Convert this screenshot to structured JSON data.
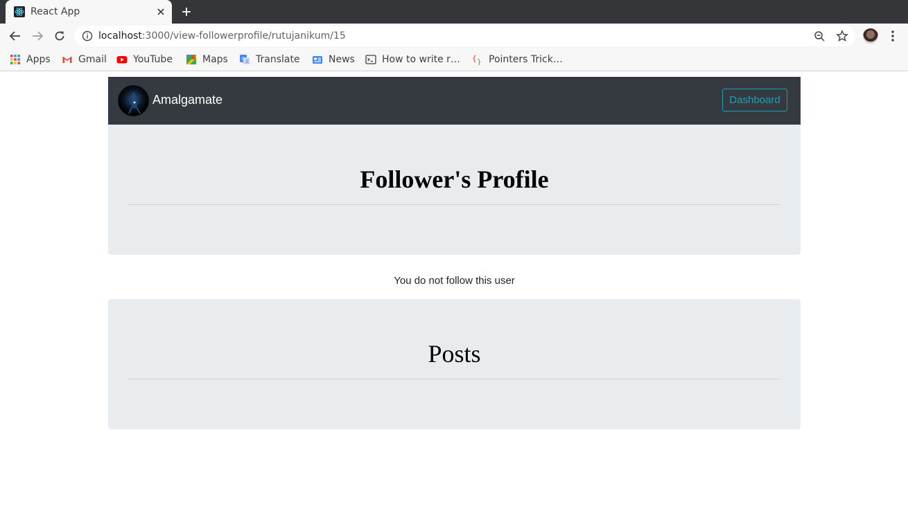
{
  "browser": {
    "tab": {
      "title": "React App",
      "favicon": "react-icon"
    },
    "url": {
      "host": "localhost",
      "path": ":3000/view-followerprofile/rutujanikum/15"
    },
    "bookmarks": [
      {
        "label": "Apps",
        "icon": "apps-grid-icon"
      },
      {
        "label": "Gmail",
        "icon": "gmail-icon"
      },
      {
        "label": "YouTube",
        "icon": "youtube-icon"
      },
      {
        "label": "Maps",
        "icon": "maps-icon"
      },
      {
        "label": "Translate",
        "icon": "translate-icon"
      },
      {
        "label": "News",
        "icon": "news-icon"
      },
      {
        "label": "How to write r…",
        "icon": "terminal-icon"
      },
      {
        "label": "Pointers Trick…",
        "icon": "braces-icon"
      }
    ]
  },
  "navbar": {
    "brand": "Amalgamate",
    "dashboard_label": "Dashboard",
    "accent": "#17a2b8",
    "background": "#343a40"
  },
  "profile": {
    "title": "Follower's Profile",
    "follow_status": "You do not follow this user"
  },
  "posts": {
    "title": "Posts"
  }
}
